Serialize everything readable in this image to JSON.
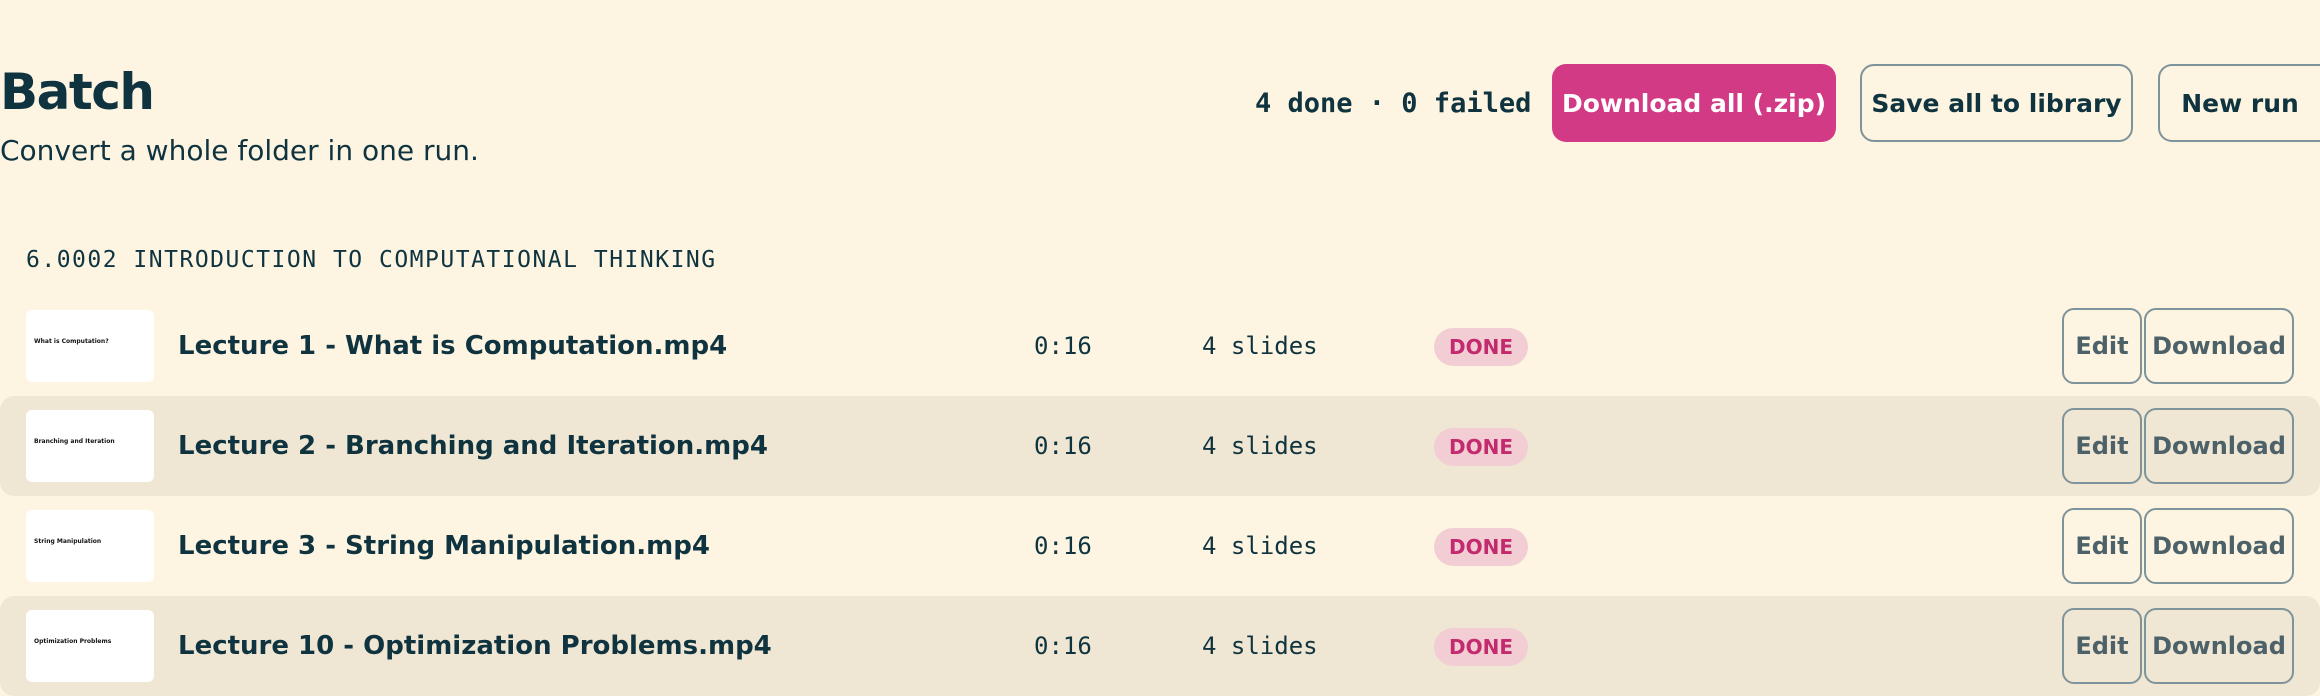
{
  "header": {
    "title": "Batch",
    "subtitle": "Convert a whole folder in one run.",
    "status": "4 done · 0 failed",
    "download_all_label": "Download all (.zip)",
    "save_all_label": "Save all to library",
    "new_run_label": "New run"
  },
  "section": {
    "title": "6.0002 INTRODUCTION TO COMPUTATIONAL THINKING"
  },
  "rows": [
    {
      "name": "Lecture 1 - What is Computation.mp4",
      "thumb_text": "What is Computation?",
      "duration": "0:16",
      "slides": "4 slides",
      "status": "DONE",
      "edit_label": "Edit",
      "download_label": "Download"
    },
    {
      "name": "Lecture 2 - Branching and Iteration.mp4",
      "thumb_text": "Branching and Iteration",
      "duration": "0:16",
      "slides": "4 slides",
      "status": "DONE",
      "edit_label": "Edit",
      "download_label": "Download"
    },
    {
      "name": "Lecture 3 - String Manipulation.mp4",
      "thumb_text": "String Manipulation",
      "duration": "0:16",
      "slides": "4 slides",
      "status": "DONE",
      "edit_label": "Edit",
      "download_label": "Download"
    },
    {
      "name": "Lecture 10 - Optimization Problems.mp4",
      "thumb_text": "Optimization Problems",
      "duration": "0:16",
      "slides": "4 slides",
      "status": "DONE",
      "edit_label": "Edit",
      "download_label": "Download"
    }
  ],
  "colors": {
    "background": "#fdf5e2",
    "text": "#0f3440",
    "accent": "#d23a85",
    "row_alt": "#efe6d3",
    "badge_bg": "#f2cdd4",
    "badge_text": "#c42a6e"
  }
}
